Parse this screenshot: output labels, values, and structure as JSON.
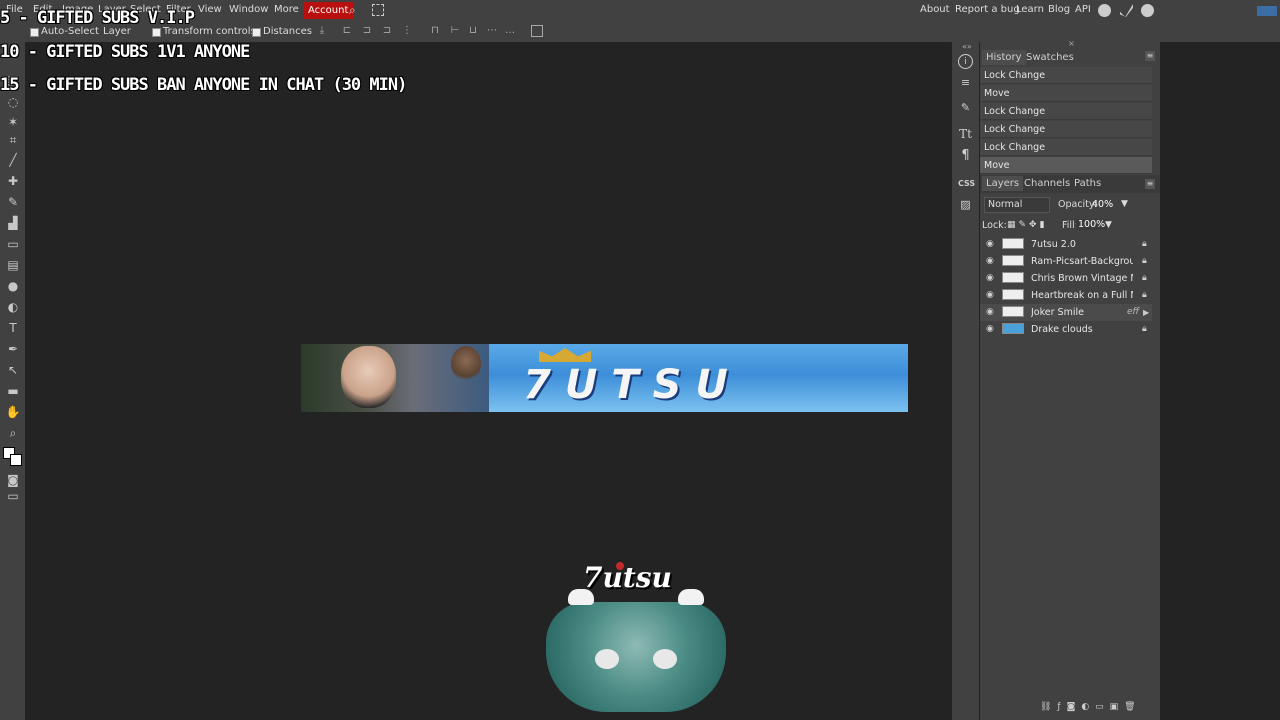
{
  "menubar": {
    "items": [
      "File",
      "Edit",
      "Image",
      "Layer",
      "Select",
      "Filter",
      "View",
      "Window",
      "More"
    ],
    "account_label": "Account",
    "right_links": [
      "About",
      "Report a bug",
      "Learn",
      "Blog",
      "API"
    ]
  },
  "options": {
    "auto_select_label": "Auto-Select",
    "layer_select_value": "Layer",
    "transform_controls_label": "Transform controls",
    "distances_label": "Distances"
  },
  "overlay": {
    "line1": "5 - GIFTED SUBS V.I.P",
    "line2": "10 - GIFTED SUBS 1V1 ANYONE",
    "line3": "15 - GIFTED SUBS BAN ANYONE IN CHAT (30 MIN)"
  },
  "canvas": {
    "banner_logo": "7UTSU",
    "controller_logo": "7utsu"
  },
  "history": {
    "tabs": [
      "History",
      "Swatches"
    ],
    "items": [
      "Lock Change",
      "Move",
      "Lock Change",
      "Lock Change",
      "Lock Change",
      "Move"
    ]
  },
  "layers": {
    "tabs": [
      "Layers",
      "Channels",
      "Paths"
    ],
    "blend_mode": "Normal",
    "opacity_label": "Opacity:",
    "opacity_value": "40%",
    "lock_label": "Lock:",
    "fill_label": "Fill:",
    "fill_value": "100%",
    "items": [
      {
        "name": "7utsu 2.0",
        "badge": ""
      },
      {
        "name": "Ram-Picsart-Background",
        "badge": ""
      },
      {
        "name": "Chris Brown Vintage Mid",
        "badge": ""
      },
      {
        "name": "Heartbreak on a Full Moo",
        "badge": ""
      },
      {
        "name": "Joker Smile",
        "badge": "eff"
      },
      {
        "name": "Drake clouds",
        "badge": ""
      }
    ]
  },
  "colors": {
    "account_red": "#b80f0f",
    "panel_bg": "#414141",
    "workspace_bg": "#232323"
  },
  "icons": [
    "search-icon",
    "fullscreen-icon",
    "reddit-icon",
    "twitter-icon",
    "facebook-icon",
    "eye-icon",
    "lock-icon"
  ]
}
